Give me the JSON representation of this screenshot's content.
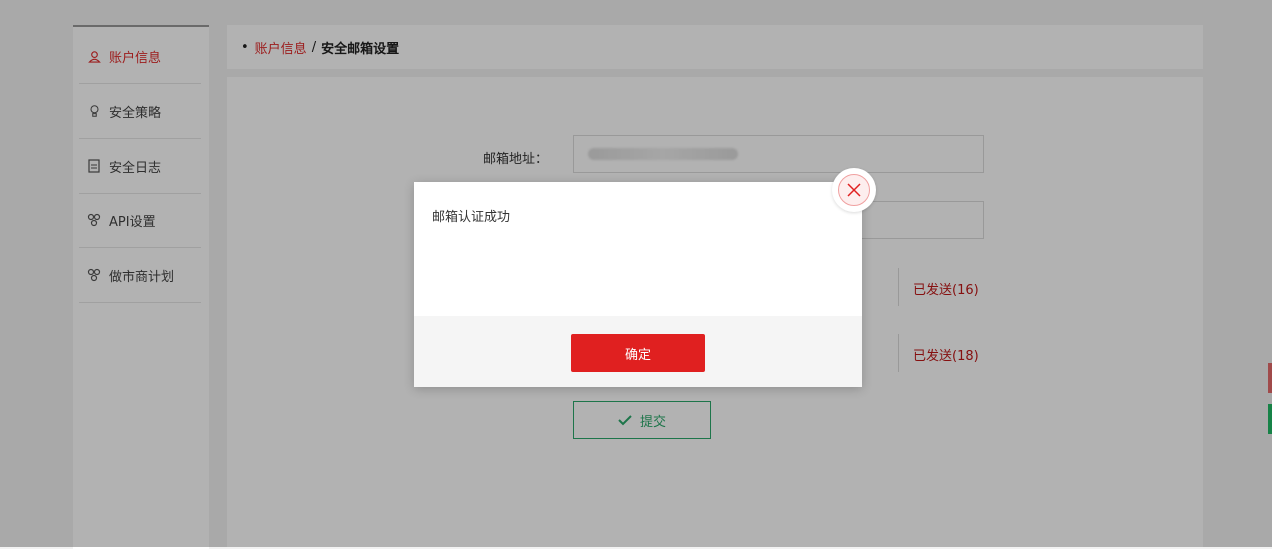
{
  "sidebar": {
    "items": [
      {
        "label": "账户信息",
        "icon": "user-icon",
        "active": true
      },
      {
        "label": "安全策略",
        "icon": "bulb-icon"
      },
      {
        "label": "安全日志",
        "icon": "document-icon"
      },
      {
        "label": "API设置",
        "icon": "cluster-icon"
      },
      {
        "label": "做市商计划",
        "icon": "cluster-icon"
      }
    ]
  },
  "breadcrumb": {
    "bullet": "•",
    "parent": "账户信息",
    "separator": "/",
    "current": "安全邮箱设置"
  },
  "form": {
    "email_label": "邮箱地址：",
    "sent_1": "已发送(16)",
    "sent_2": "已发送(18)",
    "submit_label": "提交"
  },
  "modal": {
    "message": "邮箱认证成功",
    "confirm_label": "确定"
  },
  "colors": {
    "accent": "#e02020",
    "success": "#2aa86a"
  }
}
